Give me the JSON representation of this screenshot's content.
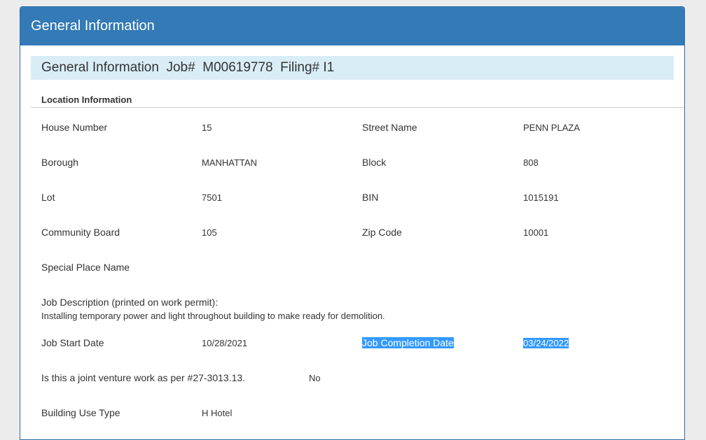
{
  "panel": {
    "title": "General Information"
  },
  "job_header": {
    "text": "General Information  Job#  M00619778  Filing# I1"
  },
  "location": {
    "title": "Location Information",
    "house_number_label": "House Number",
    "house_number": "15",
    "street_name_label": "Street Name",
    "street_name": "PENN PLAZA",
    "borough_label": "Borough",
    "borough": "MANHATTAN",
    "block_label": "Block",
    "block": "808",
    "lot_label": "Lot",
    "lot": "7501",
    "bin_label": "BIN",
    "bin": "1015191",
    "community_board_label": "Community Board",
    "community_board": "105",
    "zip_code_label": "Zip Code",
    "zip_code": "10001",
    "special_place_label": "Special Place Name",
    "job_description_label": "Job Description (printed on work permit):",
    "job_description": "Installing temporary power and light throughout building to make ready for demolition.",
    "job_start_label": "Job Start Date",
    "job_start": "10/28/2021",
    "job_completion_label": "Job Completion Date",
    "job_completion": "03/24/2022",
    "joint_venture_label": "Is this a joint venture work as per #27-3013.13.",
    "joint_venture": "No",
    "building_use_label": "Building Use Type",
    "building_use": "H Hotel"
  },
  "colors": {
    "heading_bg": "#337ab7",
    "subheading_bg": "#d9edf7",
    "selection": "#3399ff"
  }
}
